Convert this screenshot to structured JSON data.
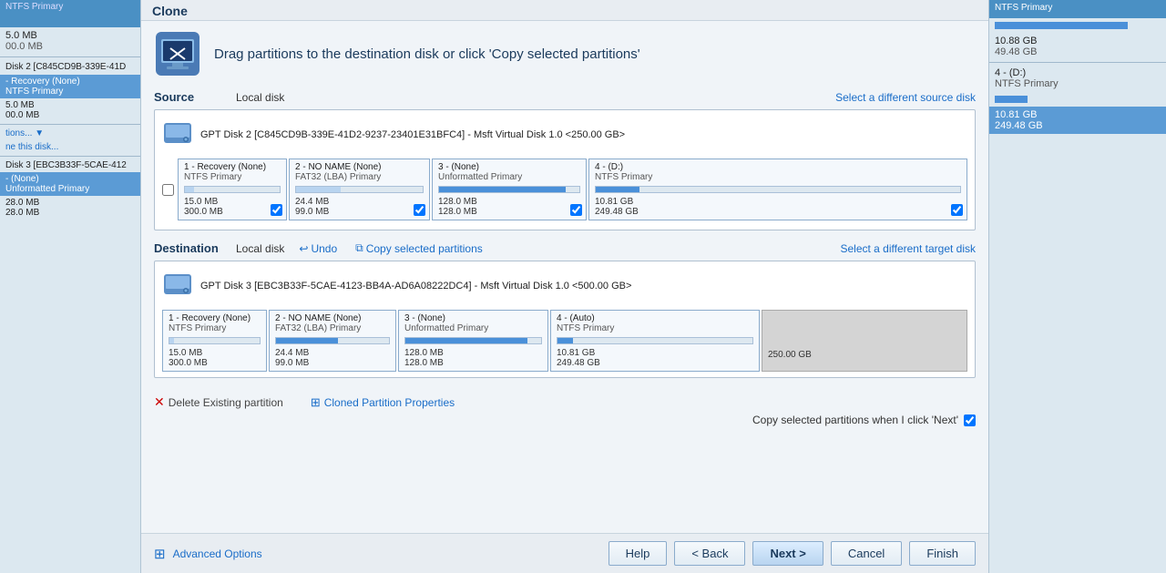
{
  "title": "Clone",
  "instruction": "Drag partitions to the destination disk or click 'Copy selected partitions'",
  "source": {
    "label": "Source",
    "sub_label": "Local disk",
    "select_link": "Select a different source disk",
    "disk_info": "GPT Disk 2 [C845CD9B-339E-41D2-9237-23401E31BFC4] - Msft     Virtual Disk    1.0  <250.00 GB>",
    "partitions": [
      {
        "name": "1 - Recovery (None)",
        "type": "NTFS Primary",
        "bar_pct": 10,
        "bar_color": "light",
        "size1": "15.0 MB",
        "size2": "300.0 MB",
        "checked": true
      },
      {
        "name": "2 - NO NAME (None)",
        "type": "FAT32 (LBA) Primary",
        "bar_pct": 35,
        "bar_color": "light",
        "size1": "24.4 MB",
        "size2": "99.0 MB",
        "checked": true
      },
      {
        "name": "3 - (None)",
        "type": "Unformatted Primary",
        "bar_pct": 90,
        "bar_color": "blue",
        "size1": "128.0 MB",
        "size2": "128.0 MB",
        "checked": true
      },
      {
        "name": "4 - (D:)",
        "type": "NTFS Primary",
        "bar_pct": 12,
        "bar_color": "blue",
        "size1": "10.81 GB",
        "size2": "249.48 GB",
        "checked": true
      }
    ]
  },
  "destination": {
    "label": "Destination",
    "sub_label": "Local disk",
    "undo_label": "Undo",
    "copy_label": "Copy selected partitions",
    "select_link": "Select a different target disk",
    "disk_info": "GPT Disk 3 [EBC3B33F-5CAE-4123-BB4A-AD6A08222DC4] - Msft     Virtual Disk    1.0  <500.00 GB>",
    "partitions": [
      {
        "name": "1 - Recovery (None)",
        "type": "NTFS Primary",
        "bar_pct": 5,
        "bar_color": "light",
        "size1": "15.0 MB",
        "size2": "300.0 MB"
      },
      {
        "name": "2 - NO NAME (None)",
        "type": "FAT32 (LBA) Primary",
        "bar_pct": 55,
        "bar_color": "blue",
        "size1": "24.4 MB",
        "size2": "99.0 MB"
      },
      {
        "name": "3 - (None)",
        "type": "Unformatted Primary",
        "bar_pct": 90,
        "bar_color": "blue",
        "size1": "128.0 MB",
        "size2": "128.0 MB"
      },
      {
        "name": "4 - (Auto)",
        "type": "NTFS Primary",
        "bar_pct": 8,
        "bar_color": "blue",
        "size1": "10.81 GB",
        "size2": "249.48 GB"
      }
    ],
    "free_size": "250.00 GB"
  },
  "delete_label": "Delete Existing partition",
  "cloned_props_label": "Cloned Partition Properties",
  "copy_when_label": "Copy selected partitions when I click 'Next'",
  "footer": {
    "advanced_label": "Advanced Options",
    "help_label": "Help",
    "back_label": "< Back",
    "next_label": "Next >",
    "cancel_label": "Cancel",
    "finish_label": "Finish"
  },
  "sidebar": {
    "items": [
      {
        "label": "5.0 MB",
        "sub": "00.0 MB",
        "selected": false
      },
      {
        "label": "Disk 2 [C845CD9B-339E-41D",
        "selected": false
      },
      {
        "label": "- Recovery (None)",
        "sub": "NTFS Primary",
        "selected": false
      },
      {
        "label": "5.0 MB",
        "sub": "00.0 MB",
        "selected": false
      }
    ]
  },
  "right_panel": {
    "top_label": "NTFS Primary",
    "items": [
      {
        "label": "4 - (D:)",
        "sub": "NTFS Primary",
        "selected": false
      },
      {
        "label": "10.88 GB",
        "sub": "49.48 GB",
        "selected": false
      },
      {
        "label": "4 - (D:)",
        "sub": "NTFS Primary",
        "selected": false
      },
      {
        "label": "10.81 GB",
        "sub": "249.48 GB",
        "selected": true
      }
    ]
  }
}
